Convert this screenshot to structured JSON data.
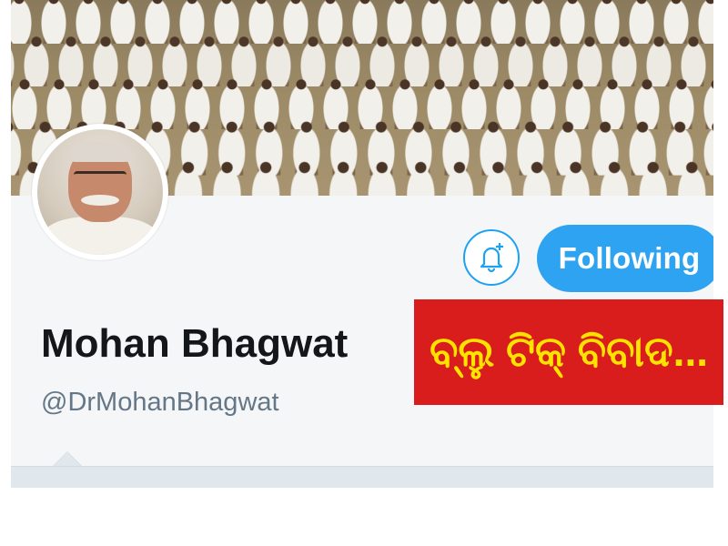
{
  "profile": {
    "display_name": "Mohan Bhagwat",
    "handle": "@DrMohanBhagwat"
  },
  "actions": {
    "notifications_icon": "bell-plus-icon",
    "following_label": "Following"
  },
  "overlay": {
    "headline": "ବ୍ଲୁ ଟିକ୍ ବିବାଦ...",
    "background_color": "#d91d1d",
    "text_color": "#ffe300"
  },
  "colors": {
    "accent": "#1da1f2",
    "following_bg": "#2ea3f2",
    "name_text": "#14171a",
    "handle_text": "#657786"
  }
}
